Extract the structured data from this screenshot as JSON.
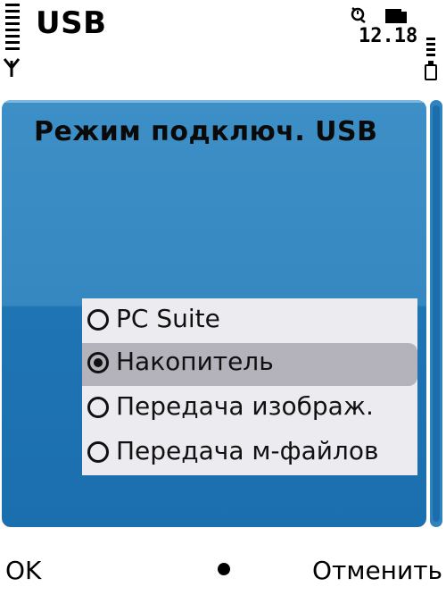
{
  "statusbar": {
    "title": "USB",
    "time": "12.18"
  },
  "dialog": {
    "title": "Режим подключ. USB",
    "options": [
      {
        "label": "PC Suite",
        "selected": false
      },
      {
        "label": "Накопитель",
        "selected": true
      },
      {
        "label": "Передача изображ.",
        "selected": false
      },
      {
        "label": "Передача м-файлов",
        "selected": false
      }
    ]
  },
  "softkeys": {
    "left": "OK",
    "right": "Отменить"
  },
  "colors": {
    "panel_blue": "#3688c1",
    "list_bg": "#ececf0",
    "highlight": "#b4b3bb"
  },
  "icons": {
    "signal": "signal-strength-icon",
    "antenna": "antenna-icon",
    "alarm": "alarm-clock-icon",
    "memory": "memory-card-icon",
    "battery": "battery-level-icon"
  }
}
